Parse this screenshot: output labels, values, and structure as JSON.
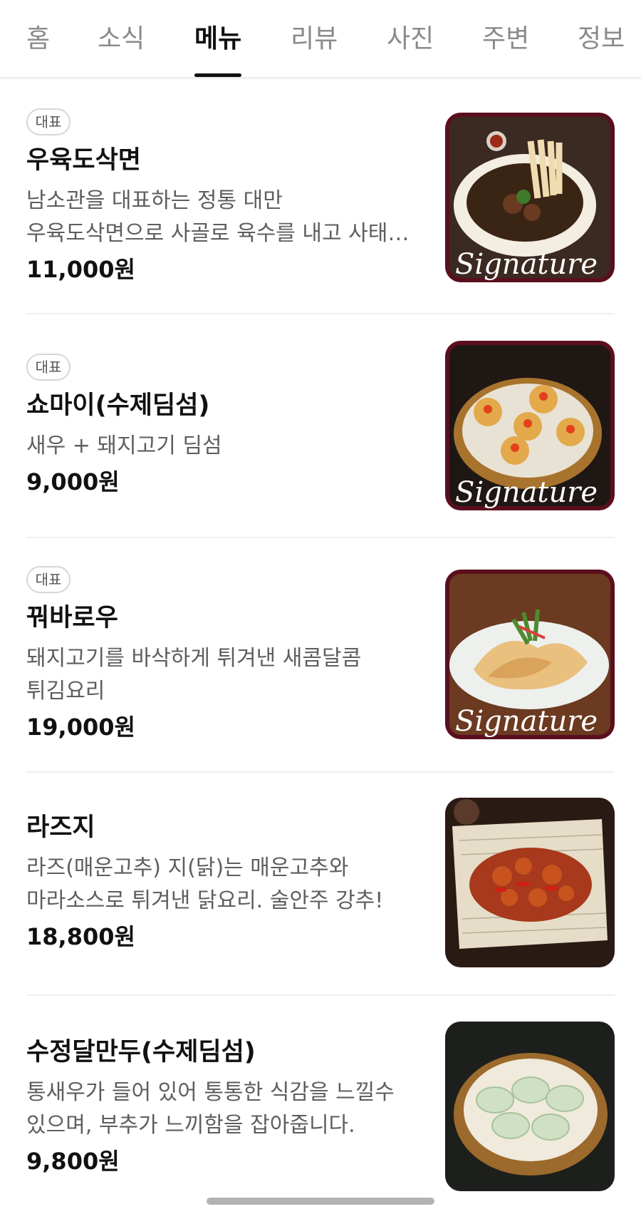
{
  "tabs": [
    {
      "label": "홈",
      "active": false
    },
    {
      "label": "소식",
      "active": false
    },
    {
      "label": "메뉴",
      "active": true
    },
    {
      "label": "리뷰",
      "active": false
    },
    {
      "label": "사진",
      "active": false
    },
    {
      "label": "주변",
      "active": false
    },
    {
      "label": "정보",
      "active": false
    }
  ],
  "menu": {
    "items": [
      {
        "badge": "대표",
        "name": "우육도삭면",
        "description": "남소관을 대표하는 정통 대만 우육도삭면으로 사골로 육수를 내고 사태를 직접 삶아 만든 요리",
        "price": "11,000원",
        "image_overlay": "Signature",
        "image_subject": "beef-noodle-soup"
      },
      {
        "badge": "대표",
        "name": "쇼마이(수제딤섬)",
        "description": "새우 + 돼지고기 딤섬",
        "price": "9,000원",
        "image_overlay": "Signature",
        "image_subject": "shumai-dimsum"
      },
      {
        "badge": "대표",
        "name": "꿔바로우",
        "description": "돼지고기를 바삭하게 튀겨낸 새콤달콤 튀김요리",
        "price": "19,000원",
        "image_overlay": "Signature",
        "image_subject": "guobaorou"
      },
      {
        "badge": "",
        "name": "라즈지",
        "description": "라즈(매운고추) 지(닭)는 매운고추와 마라소스로 튀겨낸 닭요리. 술안주 강추!",
        "price": "18,800원",
        "image_overlay": "",
        "image_subject": "laziji-chicken"
      },
      {
        "badge": "",
        "name": "수정달만두(수제딤섬)",
        "description": "통새우가 들어 있어 통통한 식감을 느낄수 있으며, 부추가 느끼함을 잡아줍니다.",
        "price": "9,800원",
        "image_overlay": "",
        "image_subject": "crystal-dumplings"
      }
    ]
  },
  "colors": {
    "accent": "#111111",
    "muted_text": "#5e5e5e",
    "inactive_tab": "#8a8a8a",
    "signature_frame": "#5a0f1e"
  }
}
